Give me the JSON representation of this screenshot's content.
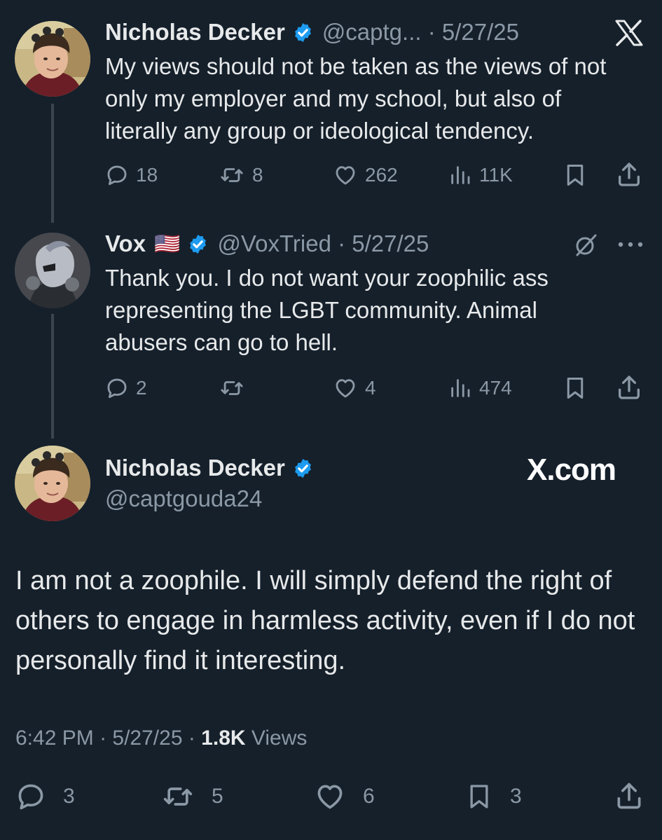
{
  "tweet1": {
    "author": "Nicholas Decker",
    "handle": "@captg...",
    "date": "5/27/25",
    "text": "My views should not be taken as the views of not only my employer and my school, but also of literally any group or ideological tendency.",
    "replies": "18",
    "reposts": "8",
    "likes": "262",
    "views": "11K",
    "icons": [
      "verified-badge-icon",
      "x-logo-icon",
      "reply-icon",
      "repost-icon",
      "like-icon",
      "views-icon",
      "bookmark-icon",
      "share-icon"
    ]
  },
  "tweet2": {
    "author": "Vox",
    "flag": "🇺🇸",
    "handle": "@VoxTried",
    "date": "5/27/25",
    "text": "Thank you. I do not want your zoophilic ass representing the LGBT community. Animal abusers can go to hell.",
    "replies": "2",
    "likes": "4",
    "views": "474",
    "icons": [
      "verified-badge-icon",
      "grok-icon",
      "more-icon",
      "reply-icon",
      "repost-icon",
      "like-icon",
      "views-icon",
      "bookmark-icon",
      "share-icon"
    ]
  },
  "main_tweet": {
    "author": "Nicholas Decker",
    "handle": "@captgouda24",
    "watermark": "X.com",
    "text": "I am not a zoophile. I will simply defend the right of others to engage in harmless activity, even if I do not personally find it interesting.",
    "time": "6:42 PM",
    "date": "5/27/25",
    "views_count": "1.8K",
    "views_label": "Views",
    "replies": "3",
    "reposts": "5",
    "likes": "6",
    "bookmarks": "3",
    "icons": [
      "verified-badge-icon",
      "reply-icon",
      "repost-icon",
      "like-icon",
      "bookmark-icon",
      "share-icon"
    ]
  },
  "colors": {
    "background": "#15202b",
    "text": "#e7e9ea",
    "muted": "#8b98a5",
    "verified": "#1d9bf0",
    "thread_line": "#3a4550"
  }
}
